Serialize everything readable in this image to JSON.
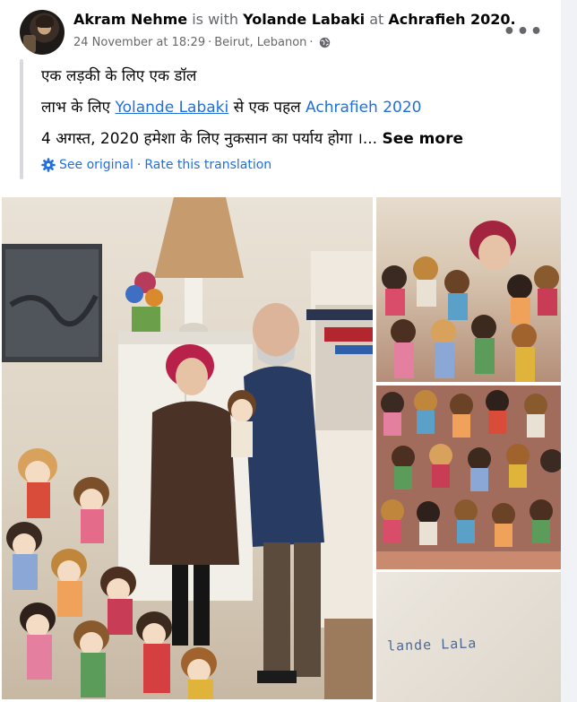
{
  "post": {
    "author": "Akram Nehme",
    "with_word": "is with",
    "tagged": "Yolande Labaki",
    "at_word": "at",
    "place": "Achrafieh 2020.",
    "date": "24 November at 18:29",
    "meta_sep": "·",
    "location": "Beirut, Lebanon",
    "privacy_icon": "globe-icon",
    "more_label": "•••"
  },
  "translation": {
    "line1": "एक लड़की के लिए एक डॉल",
    "line2_prefix": "लाभ के लिए ",
    "line2_link": "Yolande Labaki",
    "line2_mid": " से एक पहल ",
    "line2_tag": "Achrafieh 2020",
    "line3": "4 अगस्त, 2020 हमेशा के लिए नुकसान का पर्याय होगा ।... ",
    "see_more": "See more",
    "see_original": "See original",
    "separator": "·",
    "rate_translation": "Rate this translation",
    "settings_icon": "gear-icon"
  },
  "photos": {
    "count": 4,
    "caption_fragment": "lande  LaLa"
  },
  "colors": {
    "link": "#216fdb",
    "secondary_text": "#65676b",
    "primary_text": "#050505"
  }
}
